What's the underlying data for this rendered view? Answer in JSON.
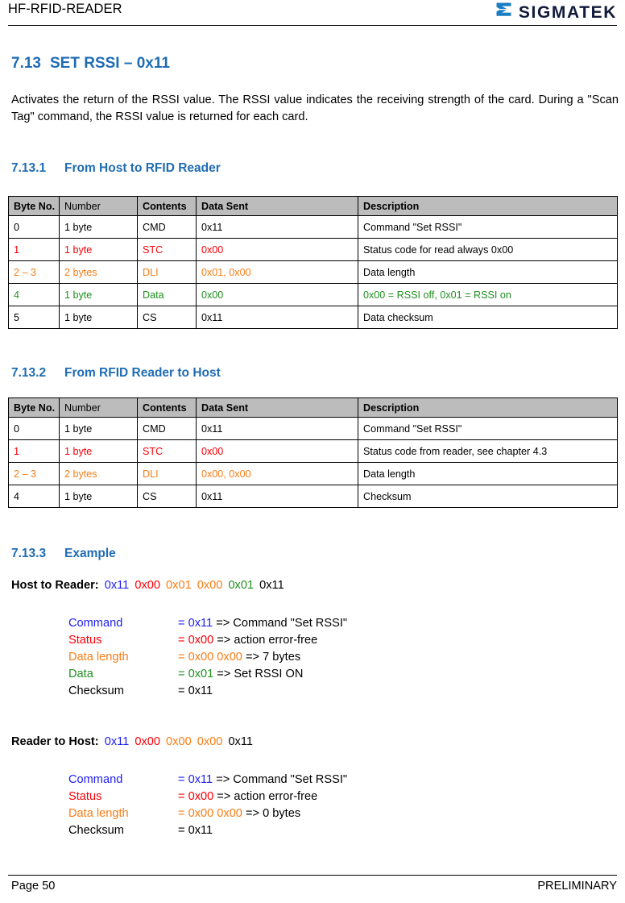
{
  "colors": {
    "heading_blue": "#1f6cb4",
    "accent_red": "#fb0007",
    "accent_orange": "#f97d16",
    "accent_green": "#1f9020",
    "accent_blue": "#2020f0",
    "table_header_gray": "#bcbcbc",
    "logo_navy": "#111a3a",
    "logo_blue": "#1b7ec4"
  },
  "header": {
    "doc_title": "HF-RFID-READER",
    "logo_text": "SIGMATEK"
  },
  "section": {
    "number": "7.13",
    "title": "SET RSSI – 0x11",
    "intro": "Activates the return of the RSSI value. The RSSI value indicates the receiving strength of the card. During a \"Scan Tag\" command, the RSSI value is returned for each card."
  },
  "subsection_1": {
    "number": "7.13.1",
    "title": "From Host to RFID Reader",
    "table": {
      "headers": [
        "Byte No.",
        "Number",
        "Contents",
        "Data Sent",
        "Description"
      ],
      "rows": [
        {
          "color": "black",
          "cells": [
            "0",
            "1 byte",
            "CMD",
            "0x11",
            "Command \"Set RSSI\""
          ],
          "desc_color": "black"
        },
        {
          "color": "red",
          "cells": [
            "1",
            "1 byte",
            "STC",
            "0x00",
            "Status code for read always 0x00"
          ],
          "desc_color": "black"
        },
        {
          "color": "orange",
          "cells": [
            "2 – 3",
            "2 bytes",
            "DLI",
            "0x01, 0x00",
            "Data length"
          ],
          "desc_color": "black"
        },
        {
          "color": "green",
          "cells": [
            "4",
            "1 byte",
            "Data",
            "0x00",
            "0x00 = RSSI off, 0x01 = RSSI on"
          ],
          "desc_color": "green"
        },
        {
          "color": "black",
          "cells": [
            "5",
            "1 byte",
            "CS",
            "0x11",
            "Data checksum"
          ],
          "desc_color": "black"
        }
      ]
    }
  },
  "subsection_2": {
    "number": "7.13.2",
    "title": "From RFID Reader to Host",
    "table": {
      "headers": [
        "Byte No.",
        "Number",
        "Contents",
        "Data Sent",
        "Description"
      ],
      "rows": [
        {
          "color": "black",
          "cells": [
            "0",
            "1 byte",
            "CMD",
            "0x11",
            "Command \"Set RSSI\""
          ],
          "desc_color": "black"
        },
        {
          "color": "red",
          "cells": [
            "1",
            "1 byte",
            "STC",
            "0x00",
            "Status code from reader, see chapter 4.3"
          ],
          "desc_color": "black"
        },
        {
          "color": "orange",
          "cells": [
            "2 – 3",
            "2 bytes",
            "DLI",
            "0x00, 0x00",
            "Data length"
          ],
          "desc_color": "black"
        },
        {
          "color": "black",
          "cells": [
            "4",
            "1 byte",
            "CS",
            "0x11",
            "Checksum"
          ],
          "desc_color": "black"
        }
      ]
    }
  },
  "subsection_3": {
    "number": "7.13.3",
    "title": "Example",
    "host_to_reader": {
      "label": "Host to Reader:",
      "bytes": [
        {
          "text": "0x11",
          "color": "blue"
        },
        {
          "text": "0x00",
          "color": "red"
        },
        {
          "text": "0x01",
          "color": "orange"
        },
        {
          "text": "0x00",
          "color": "orange"
        },
        {
          "text": "0x01",
          "color": "green"
        },
        {
          "text": "0x11",
          "color": "black"
        }
      ],
      "details": [
        {
          "label": "Command",
          "label_color": "blue",
          "eq": "= 0x11",
          "eq_color": "blue",
          "rest": " => Command \"Set RSSI\""
        },
        {
          "label": "Status",
          "label_color": "red",
          "eq": "= 0x00",
          "eq_color": "red",
          "rest": " => action error-free"
        },
        {
          "label": "Data length",
          "label_color": "orange",
          "eq": "=  0x00 0x00",
          "eq_color": "orange",
          "rest": " => 7 bytes"
        },
        {
          "label": "Data",
          "label_color": "green",
          "eq": "= 0x01",
          "eq_color": "green",
          "rest": " => Set RSSI ON"
        },
        {
          "label": "Checksum",
          "label_color": "black",
          "eq": "= 0x11",
          "eq_color": "black",
          "rest": ""
        }
      ]
    },
    "reader_to_host": {
      "label": "Reader to Host:",
      "bytes": [
        {
          "text": "0x11",
          "color": "blue"
        },
        {
          "text": "0x00",
          "color": "red"
        },
        {
          "text": "0x00",
          "color": "orange"
        },
        {
          "text": "0x00",
          "color": "orange"
        },
        {
          "text": "0x11",
          "color": "black"
        }
      ],
      "details": [
        {
          "label": "Command",
          "label_color": "blue",
          "eq": "= 0x11",
          "eq_color": "blue",
          "rest": " => Command \"Set RSSI\""
        },
        {
          "label": "Status",
          "label_color": "red",
          "eq": "= 0x00",
          "eq_color": "red",
          "rest": " => action error-free"
        },
        {
          "label": "Data length",
          "label_color": "orange",
          "eq": "=  0x00 0x00",
          "eq_color": "orange",
          "rest": " => 0 bytes"
        },
        {
          "label": "Checksum",
          "label_color": "black",
          "eq": "= 0x11",
          "eq_color": "black",
          "rest": ""
        }
      ]
    }
  },
  "footer": {
    "page_label": "Page 50",
    "status": "PRELIMINARY"
  }
}
